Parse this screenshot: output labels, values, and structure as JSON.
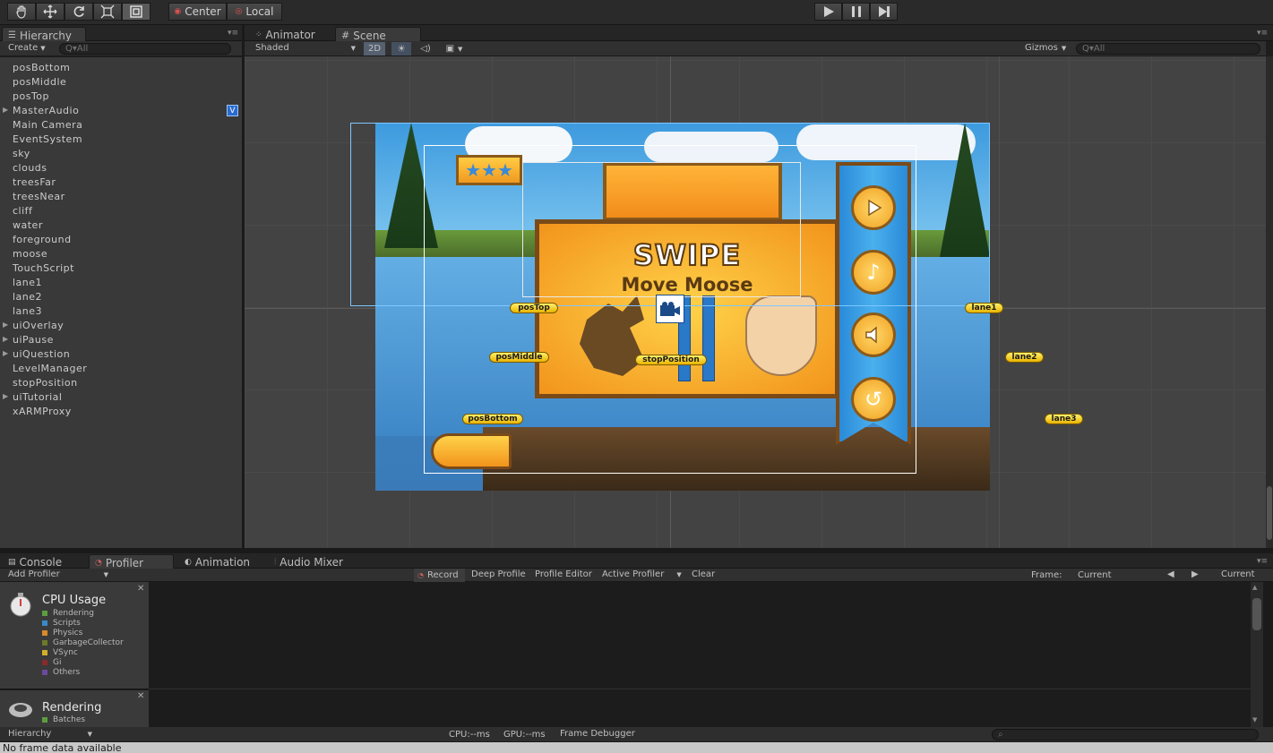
{
  "toolbar": {
    "tools": [
      "hand-tool-icon",
      "move-tool-icon",
      "rotate-tool-icon",
      "scale-tool-icon",
      "rect-tool-icon"
    ],
    "pivot": "Center",
    "space": "Local"
  },
  "hierarchy": {
    "tab": "Hierarchy",
    "create": "Create",
    "search_placeholder": "Q▾All",
    "items": [
      "posBottom",
      "posMiddle",
      "posTop",
      "MasterAudio",
      "Main Camera",
      "EventSystem",
      "sky",
      "clouds",
      "treesFar",
      "treesNear",
      "cliff",
      "water",
      "foreground",
      "moose",
      "TouchScript",
      "lane1",
      "lane2",
      "lane3",
      "uiOverlay",
      "uiPause",
      "uiQuestion",
      "LevelManager",
      "stopPosition",
      "uiTutorial",
      "xARMProxy"
    ],
    "expandable": [
      3,
      18,
      19,
      20,
      23
    ]
  },
  "scene": {
    "tabs": [
      "Animator",
      "Scene"
    ],
    "shading": "Shaded",
    "mode_2d": "2D",
    "gizmos": "Gizmos",
    "search_placeholder": "Q▾All",
    "banner_title": "SWIPE",
    "banner_subtitle": "Move Moose",
    "markers": {
      "posTop": "posTop",
      "posMiddle": "posMiddle",
      "posBottom": "posBottom",
      "stopPosition": "stopPosition",
      "lane1": "lane1",
      "lane2": "lane2",
      "lane3": "lane3"
    },
    "menu_buttons": [
      "play-icon",
      "music-icon",
      "sound-icon",
      "restart-icon"
    ],
    "stars": "★★★"
  },
  "bottom": {
    "tabs": [
      "Console",
      "Profiler",
      "Animation",
      "Audio Mixer"
    ],
    "add_profiler": "Add Profiler",
    "buttons": [
      "Record",
      "Deep Profile",
      "Profile Editor",
      "Active Profiler",
      "Clear"
    ],
    "frame_label": "Frame:",
    "frame_value": "Current",
    "current": "Current",
    "cpu_title": "CPU Usage",
    "cpu_legend": [
      {
        "label": "Rendering",
        "color": "#5c9e3f"
      },
      {
        "label": "Scripts",
        "color": "#3a88c6"
      },
      {
        "label": "Physics",
        "color": "#d98a2b"
      },
      {
        "label": "GarbageCollector",
        "color": "#6c7a2a"
      },
      {
        "label": "VSync",
        "color": "#d0b02a"
      },
      {
        "label": "Gi",
        "color": "#8a2a2a"
      },
      {
        "label": "Others",
        "color": "#6a4a9a"
      }
    ],
    "render_title": "Rendering",
    "render_legend": [
      {
        "label": "Batches",
        "color": "#5c9e3f"
      }
    ],
    "footer_dropdown": "Hierarchy",
    "cpu_ms": "CPU:--ms",
    "gpu_ms": "GPU:--ms",
    "frame_debugger": "Frame Debugger",
    "status": "No frame data available"
  }
}
